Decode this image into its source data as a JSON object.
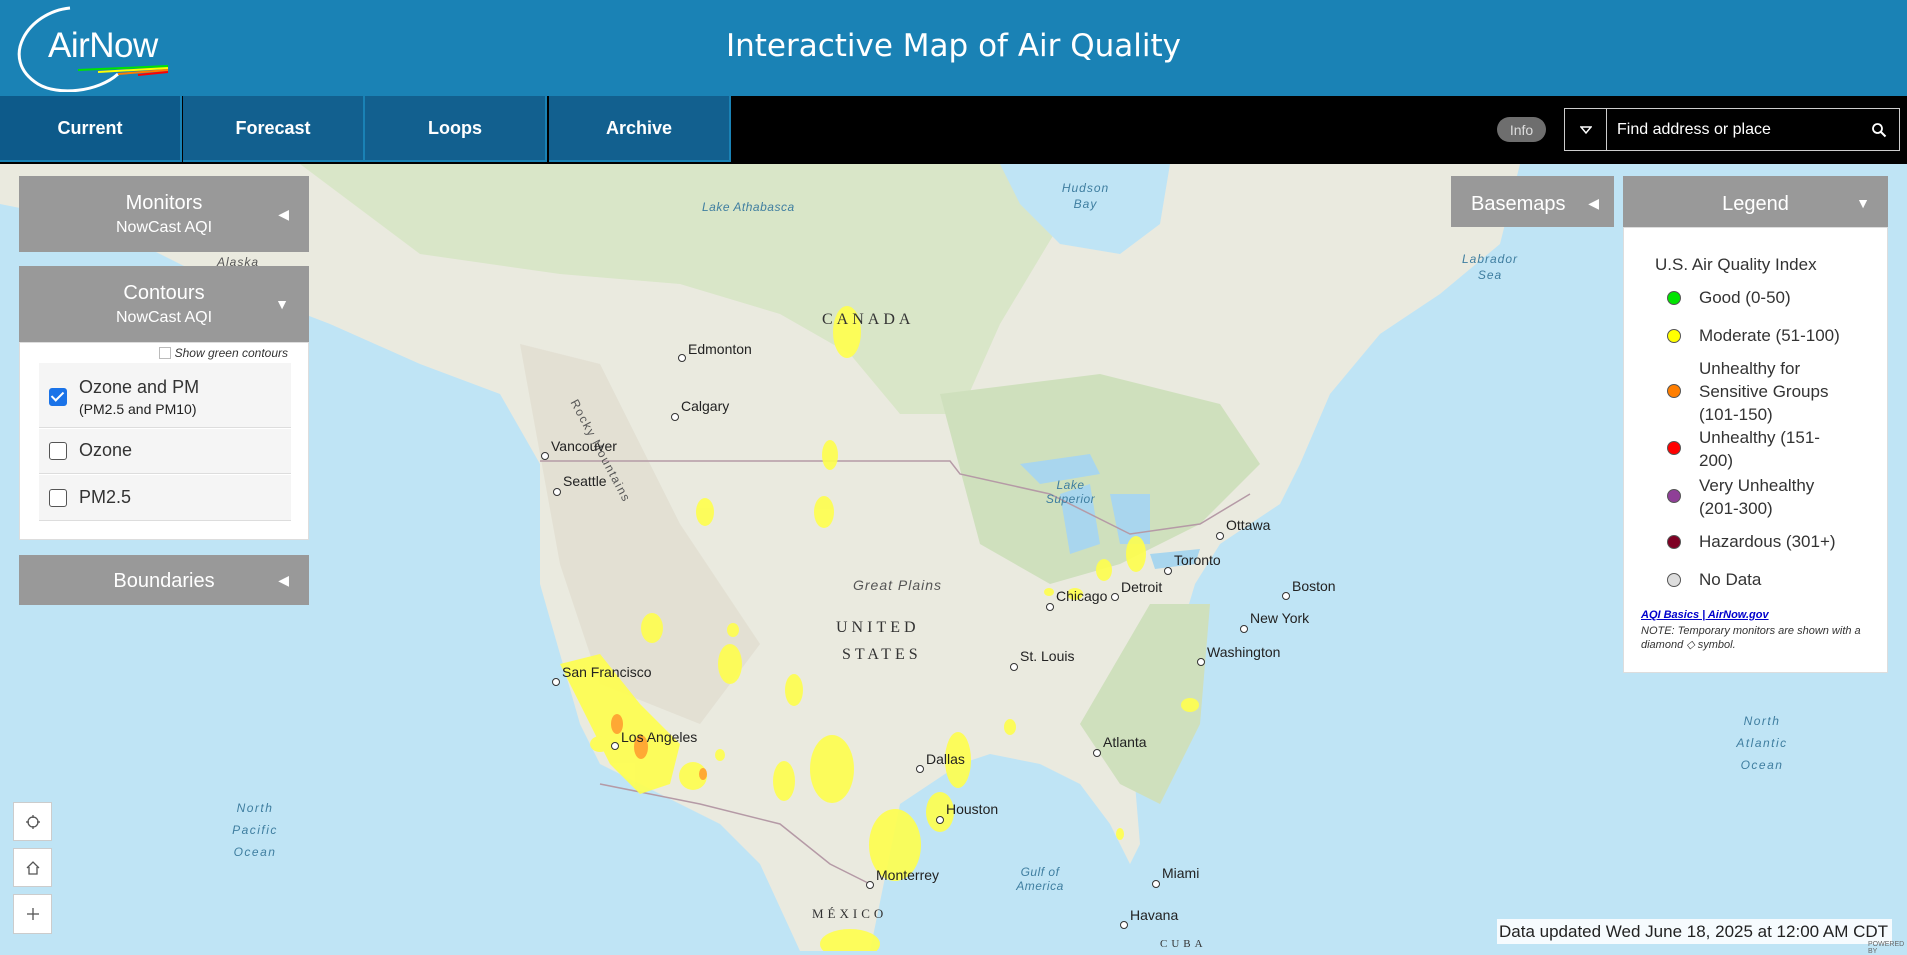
{
  "header": {
    "logo_text": "AirNow",
    "title": "Interactive Map of Air Quality"
  },
  "nav": {
    "tabs": [
      {
        "label": "Current",
        "active": true
      },
      {
        "label": "Forecast",
        "active": false
      },
      {
        "label": "Loops",
        "active": false
      },
      {
        "label": "Archive",
        "active": false
      }
    ],
    "info_label": "Info",
    "search_placeholder": "Find address or place"
  },
  "left_panels": {
    "monitors": {
      "title": "Monitors",
      "subtitle": "NowCast AQI"
    },
    "contours": {
      "title": "Contours",
      "subtitle": "NowCast AQI",
      "green_toggle_label": "Show green contours",
      "green_toggle_checked": false,
      "options": [
        {
          "label": "Ozone and PM",
          "sublabel": "(PM2.5 and PM10)",
          "checked": true
        },
        {
          "label": "Ozone",
          "checked": false
        },
        {
          "label": "PM2.5",
          "checked": false
        }
      ]
    },
    "boundaries": {
      "title": "Boundaries"
    }
  },
  "basemaps": {
    "label": "Basemaps"
  },
  "legend": {
    "header": "Legend",
    "title": "U.S. Air Quality Index",
    "items": [
      {
        "label": "Good (0-50)",
        "color": "#00e400"
      },
      {
        "label": "Moderate (51-100)",
        "color": "#ffff00"
      },
      {
        "label": "Unhealthy for Sensitive Groups (101-150)",
        "color": "#ff7e00"
      },
      {
        "label": "Unhealthy (151-200)",
        "color": "#ff0000"
      },
      {
        "label": "Very Unhealthy (201-300)",
        "color": "#8f3f97"
      },
      {
        "label": "Hazardous (301+)",
        "color": "#7e0023"
      },
      {
        "label": "No Data",
        "color": "#dddddd"
      }
    ],
    "link": "AQI Basics | AirNow.gov",
    "note": "NOTE: Temporary monitors are shown with a diamond ◇ symbol."
  },
  "map": {
    "countries": [
      "CANADA",
      "UNITED",
      "STATES",
      "MÉXICO",
      "CUBA"
    ],
    "regions": [
      "Alaska",
      "Rocky Mountains",
      "Great Plains"
    ],
    "water": [
      "Lake Athabasca",
      "Hudson Bay",
      "Labrador Sea",
      "Lake Superior",
      "North Atlantic Ocean",
      "North Pacific Ocean",
      "Gulf of America"
    ],
    "cities": [
      "Edmonton",
      "Calgary",
      "Vancouver",
      "Seattle",
      "Ottawa",
      "Toronto",
      "Detroit",
      "Chicago",
      "Boston",
      "New York",
      "Washington",
      "St. Louis",
      "San Francisco",
      "Los Angeles",
      "Atlanta",
      "Dallas",
      "Houston",
      "Miami",
      "Monterrey",
      "Havana"
    ]
  },
  "status": {
    "updated": "Data updated Wed June 18, 2025 at 12:00 AM CDT",
    "powered": "POWERED BY"
  }
}
